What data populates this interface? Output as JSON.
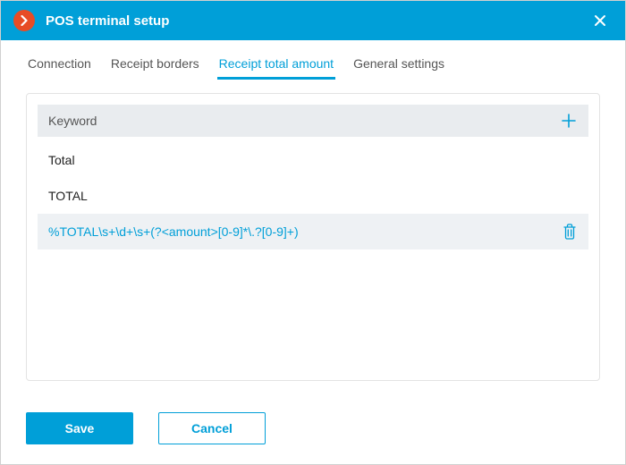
{
  "titlebar": {
    "title": "POS terminal setup"
  },
  "tabs": [
    {
      "label": "Connection"
    },
    {
      "label": "Receipt borders"
    },
    {
      "label": "Receipt total amount",
      "active": true
    },
    {
      "label": "General settings"
    }
  ],
  "panel": {
    "header": "Keyword",
    "rows": [
      {
        "text": "Total",
        "selected": false
      },
      {
        "text": "TOTAL",
        "selected": false
      },
      {
        "text": "%TOTAL\\s+\\d+\\s+(?<amount>[0-9]*\\.?[0-9]+)",
        "selected": true
      }
    ]
  },
  "footer": {
    "save_label": "Save",
    "cancel_label": "Cancel"
  },
  "colors": {
    "accent": "#009fd8",
    "badge": "#e74c25"
  }
}
